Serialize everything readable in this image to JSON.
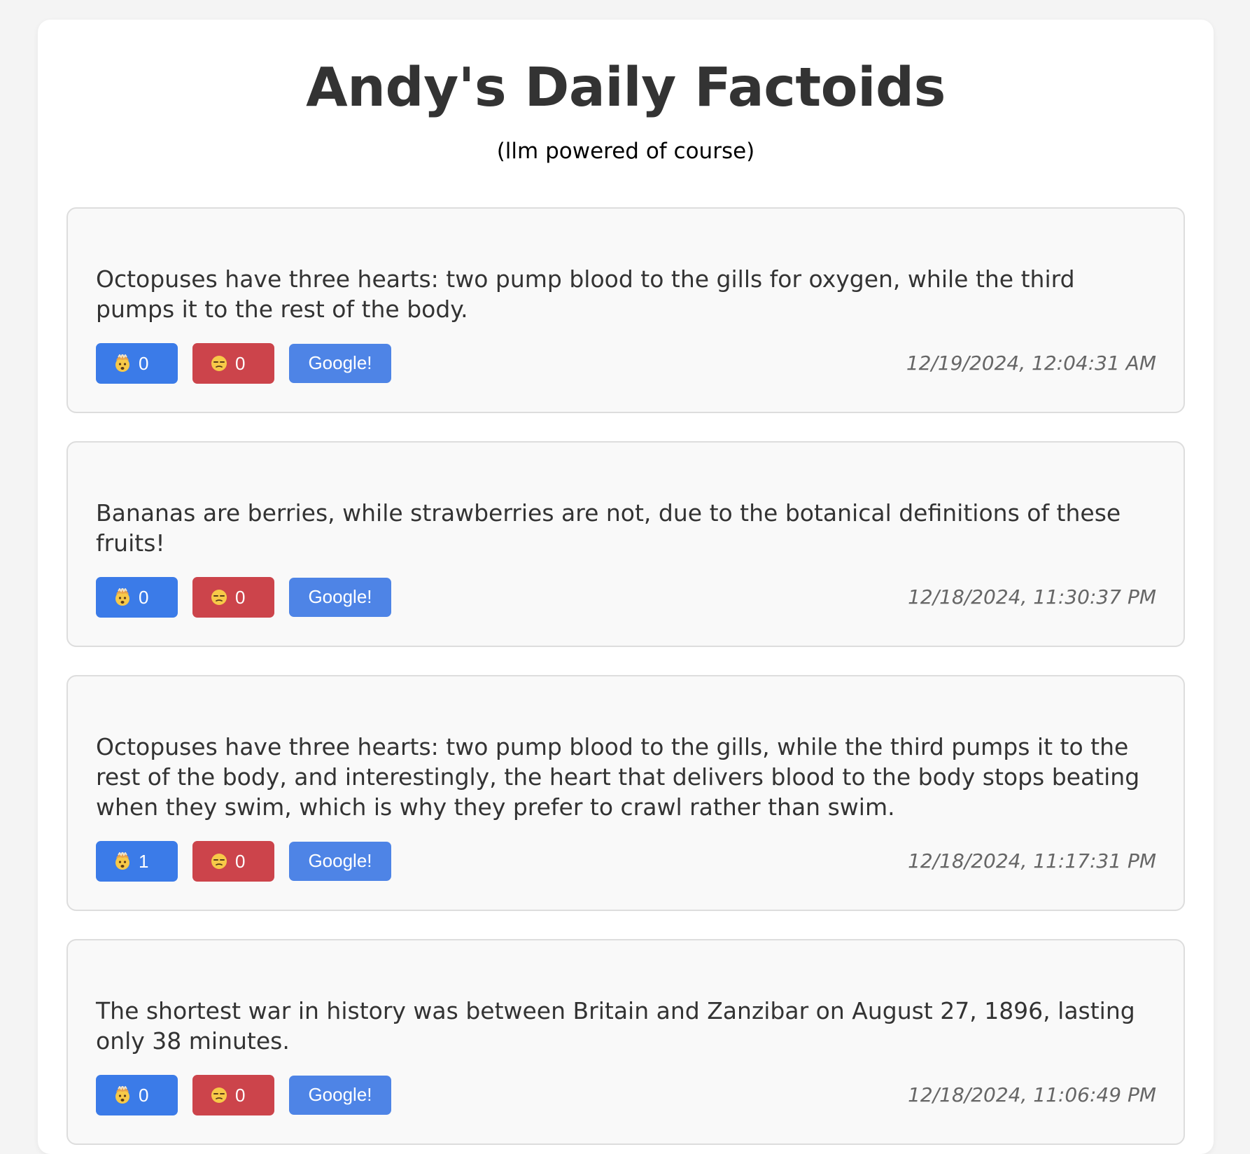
{
  "header": {
    "title": "Andy's Daily Factoids",
    "subtitle": "(llm powered of course)"
  },
  "facts": [
    {
      "text": "Octopuses have three hearts: two pump blood to the gills for oxygen, while the third pumps it to the rest of the body.",
      "mind_blown_count": "0",
      "meh_count": "0",
      "google_label": "Google!",
      "timestamp": "12/19/2024, 12:04:31 AM"
    },
    {
      "text": "Bananas are berries, while strawberries are not, due to the botanical definitions of these fruits!",
      "mind_blown_count": "0",
      "meh_count": "0",
      "google_label": "Google!",
      "timestamp": "12/18/2024, 11:30:37 PM"
    },
    {
      "text": "Octopuses have three hearts: two pump blood to the gills, while the third pumps it to the rest of the body, and interestingly, the heart that delivers blood to the body stops beating when they swim, which is why they prefer to crawl rather than swim.",
      "mind_blown_count": "1",
      "meh_count": "0",
      "google_label": "Google!",
      "timestamp": "12/18/2024, 11:17:31 PM"
    },
    {
      "text": "The shortest war in history was between Britain and Zanzibar on August 27, 1896, lasting only 38 minutes.",
      "mind_blown_count": "0",
      "meh_count": "0",
      "google_label": "Google!",
      "timestamp": "12/18/2024, 11:06:49 PM"
    }
  ],
  "icons": {
    "mind_blown": "exploding-head-emoji",
    "meh": "unamused-face-emoji"
  },
  "colors": {
    "mind_blown_button": "#3b7be8",
    "meh_button": "#cc444b",
    "google_button": "#4e84e6"
  }
}
